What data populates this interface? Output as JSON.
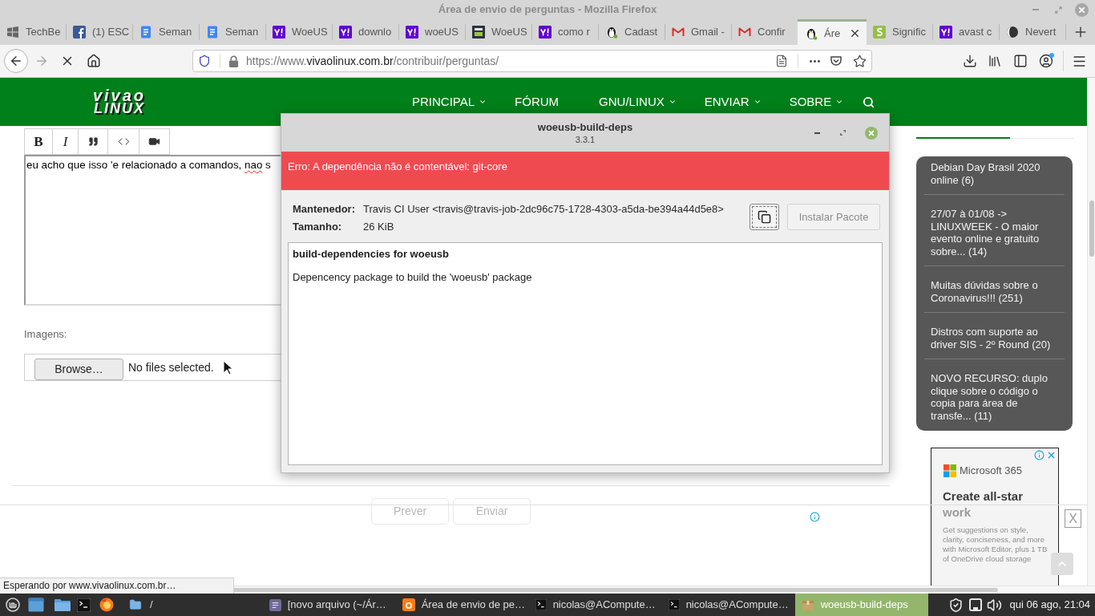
{
  "window": {
    "title": "Área de envio de perguntas - Mozilla Firefox"
  },
  "tabs": [
    {
      "label": "TechBe",
      "kind": "windows",
      "selected": false
    },
    {
      "label": "(1) ESC",
      "kind": "facebook",
      "selected": false
    },
    {
      "label": "Seman",
      "kind": "document",
      "selected": false
    },
    {
      "label": "Seman",
      "kind": "document",
      "selected": false
    },
    {
      "label": "WoeUS",
      "kind": "yahoo",
      "selected": false
    },
    {
      "label": "downlo",
      "kind": "yahoo",
      "selected": false
    },
    {
      "label": "woeUS",
      "kind": "yahoo",
      "selected": false
    },
    {
      "label": "WoeUS",
      "kind": "fossmint",
      "selected": false
    },
    {
      "label": "como r",
      "kind": "yahoo",
      "selected": false
    },
    {
      "label": "Cadast",
      "kind": "penguin",
      "selected": false
    },
    {
      "label": "Gmail -",
      "kind": "gmail",
      "selected": false
    },
    {
      "label": "Confir",
      "kind": "gmail",
      "selected": false
    },
    {
      "label": "Áre",
      "kind": "penguin",
      "selected": true
    },
    {
      "label": "Signific",
      "kind": "sheet",
      "selected": false
    },
    {
      "label": "avast c",
      "kind": "yahoo",
      "selected": false
    },
    {
      "label": "Nevert",
      "kind": "globe",
      "selected": false
    }
  ],
  "toolbar": {
    "loading": true,
    "url": {
      "prefix": "https://www.",
      "domain": "vivaolinux.com.br",
      "path": "/contribuir/perguntas/"
    },
    "account_badge": true
  },
  "site": {
    "logo": {
      "line_1": "vivao",
      "line_2": "LINUX"
    },
    "nav": [
      {
        "label": "PRINCIPAL",
        "dropdown": true
      },
      {
        "label": "FÓRUM",
        "dropdown": false
      },
      {
        "label": "GNU/LINUX",
        "dropdown": true
      },
      {
        "label": "ENVIAR",
        "dropdown": true
      },
      {
        "label": "SOBRE",
        "dropdown": true
      }
    ]
  },
  "editor": {
    "toolbar": [
      {
        "kind": "bold",
        "label": "B"
      },
      {
        "kind": "italic",
        "label": "I"
      },
      {
        "kind": "quote"
      },
      {
        "kind": "code"
      },
      {
        "kind": "video"
      }
    ],
    "text": [
      {
        "text": "eu acho que isso 'e relacionado a comandos, ",
        "misspelled": false
      },
      {
        "text": "nao",
        "misspelled": true
      },
      {
        "text": " s",
        "misspelled": false
      }
    ]
  },
  "images": {
    "label": "Imagens:",
    "browse_button": "Browse…",
    "status": "No files selected."
  },
  "form_buttons": [
    "Prever",
    "Enviar"
  ],
  "sidebar": {
    "items": [
      "Debian Day Brasil 2020 online (6)",
      "27/07 à 01/08 -> LINUXWEEK - O maior evento online e gratuito sobre... (14)",
      "Muitas dúvidas sobre o Coronavirus!!! (251)",
      "Distros com suporte ao driver SIS - 2º Round (20)",
      "NOVO RECURSO: duplo clique sobre o código o copia para área de transfe... (11)"
    ]
  },
  "ad": {
    "brand": "Microsoft 365",
    "heading_lines": [
      "Create all-star",
      "work"
    ],
    "body": "Get suggestions on style, clarity, conciseness, and more with Microsoft Editor, plus 1 TB of OneDrive cloud storage"
  },
  "bottom_banner": {
    "close": "X"
  },
  "status": "Esperando por www.vivaolinux.com.br…",
  "dialog": {
    "title": "woeusb-build-deps",
    "version": "3.3.1",
    "error": "Erro: A dependência não é contentável: git-core",
    "fields": [
      {
        "label": "Mantenedor:",
        "value": "Travis CI User <travis@travis-job-2dc96c75-1728-4303-a5da-be394a44d5e8>"
      },
      {
        "label": "Tamanho:",
        "value": "26 KiB"
      }
    ],
    "copy_button": {
      "focused": true
    },
    "install_button": {
      "label": "Instalar Pacote",
      "disabled": true
    },
    "description": {
      "title": "build-dependencies for woeusb",
      "text": "Depencency package to build the 'woeusb' package"
    }
  },
  "taskbar": {
    "launchers": [
      {
        "kind": "menu"
      },
      {
        "kind": "desktop"
      },
      {
        "kind": "files"
      },
      {
        "kind": "terminal"
      },
      {
        "kind": "firefox"
      }
    ],
    "places": {
      "label": "/"
    },
    "windows": [
      {
        "label": "[novo arquivo (~/Ár…",
        "kind": "editor",
        "selected": false
      },
      {
        "label": "Área de envio de pe…",
        "kind": "firefox",
        "selected": false
      },
      {
        "label": "nicolas@ACompute…",
        "kind": "terminal",
        "selected": false
      },
      {
        "label": "nicolas@ACompute…",
        "kind": "terminal",
        "selected": false
      },
      {
        "label": "woeusb-build-deps",
        "kind": "package",
        "selected": true
      }
    ],
    "clock": "qui 06 ago, 21:04"
  }
}
